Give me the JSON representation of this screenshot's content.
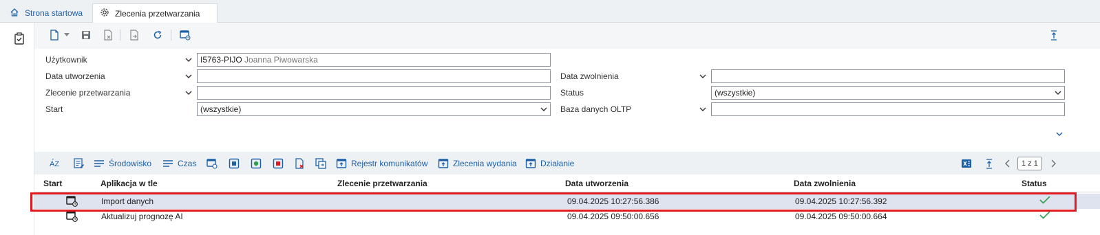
{
  "tabs": {
    "home_label": "Strona startowa",
    "active_label": "Zlecenia przetwarzania"
  },
  "form": {
    "user_label": "Użytkownik",
    "user_code": "I5763-PIJO",
    "user_name": "Joanna Piwowarska",
    "created_label": "Data utworzenia",
    "created_value": "",
    "order_label": "Zlecenie przetwarzania",
    "order_value": "",
    "start_label": "Start",
    "start_value": "(wszystkie)",
    "release_label": "Data zwolnienia",
    "release_value": "",
    "status_label": "Status",
    "status_value": "(wszystkie)",
    "oltp_label": "Baza danych OLTP",
    "oltp_value": ""
  },
  "gridbar": {
    "env_label": "Środowisko",
    "time_label": "Czas",
    "log_label": "Rejestr komunikatów",
    "release_orders_label": "Zlecenia wydania",
    "action_label": "Działanie",
    "pager": "1 z 1"
  },
  "table": {
    "headers": {
      "start": "Start",
      "app": "Aplikacja w tle",
      "order": "Zlecenie przetwarzania",
      "created": "Data utworzenia",
      "released": "Data zwolnienia",
      "status": "Status"
    },
    "rows": [
      {
        "app": "Import danych",
        "order": "",
        "created": "09.04.2025  10:27:56.386",
        "released": "09.04.2025  10:27:56.392",
        "status_icon": "check-icon"
      },
      {
        "app": "Aktualizuj prognozę AI",
        "order": "",
        "created": "09.04.2025  09:50:00.656",
        "released": "09.04.2025  09:50:00.664",
        "status_icon": "check-icon"
      }
    ]
  },
  "colors": {
    "accent": "#1b5fa8",
    "selection": "#dfe3ef",
    "highlight": "#e0181f",
    "success": "#2e9e4a"
  }
}
